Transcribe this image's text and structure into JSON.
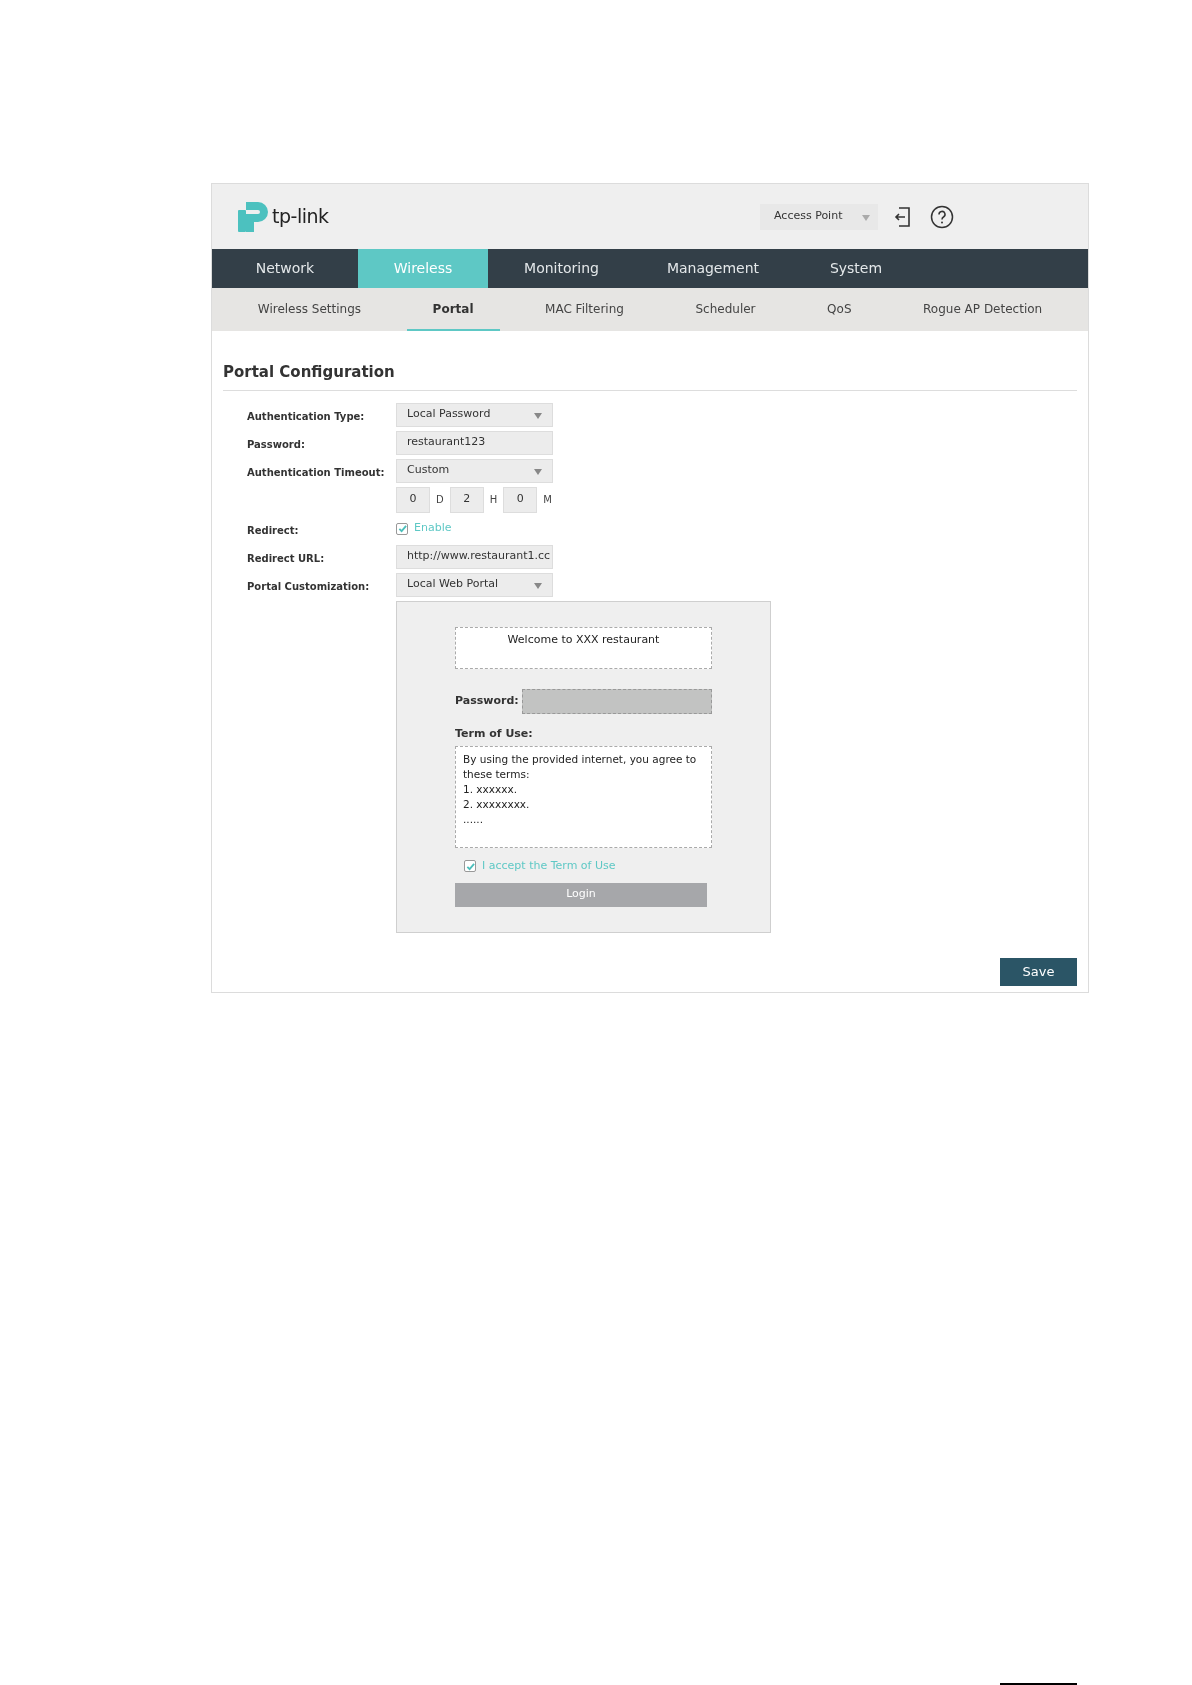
{
  "header": {
    "logo_text": "tp-link",
    "mode_select": "Access Point"
  },
  "nav": [
    {
      "label": "Network",
      "selected": false
    },
    {
      "label": "Wireless",
      "selected": true
    },
    {
      "label": "Monitoring",
      "selected": false
    },
    {
      "label": "Management",
      "selected": false
    },
    {
      "label": "System",
      "selected": false
    }
  ],
  "subnav": [
    {
      "label": "Wireless Settings",
      "selected": false
    },
    {
      "label": "Portal",
      "selected": true
    },
    {
      "label": "MAC Filtering",
      "selected": false
    },
    {
      "label": "Scheduler",
      "selected": false
    },
    {
      "label": "QoS",
      "selected": false
    },
    {
      "label": "Rogue AP Detection",
      "selected": false
    }
  ],
  "section_title": "Portal Configuration",
  "form": [
    {
      "kind": "select",
      "label": "Authentication Type:",
      "value": "Local Password"
    },
    {
      "kind": "text",
      "label": "Password:",
      "value": "restaurant123"
    },
    {
      "kind": "select",
      "label": "Authentication Timeout:",
      "value": "Custom"
    },
    {
      "kind": "duration",
      "parts": [
        {
          "value": "0",
          "unit": "D"
        },
        {
          "value": "2",
          "unit": "H"
        },
        {
          "value": "0",
          "unit": "M"
        }
      ]
    },
    {
      "kind": "checkbox",
      "label": "Redirect:",
      "text": "Enable",
      "checked": true
    },
    {
      "kind": "text",
      "label": "Redirect URL:",
      "value": "http://www.restaurant1.cc"
    },
    {
      "kind": "select",
      "label": "Portal Customization:",
      "value": "Local Web Portal"
    }
  ],
  "preview": {
    "welcome": "Welcome to XXX restaurant",
    "password_label": "Password:",
    "terms_label": "Term of Use:",
    "terms_lines": [
      "By using the provided internet, you agree to these terms:",
      "1. xxxxxx.",
      "2. xxxxxxxx.",
      "......"
    ],
    "accept_text": "I accept the Term of Use",
    "accept_checked": true,
    "login": "Login"
  },
  "save": "Save"
}
